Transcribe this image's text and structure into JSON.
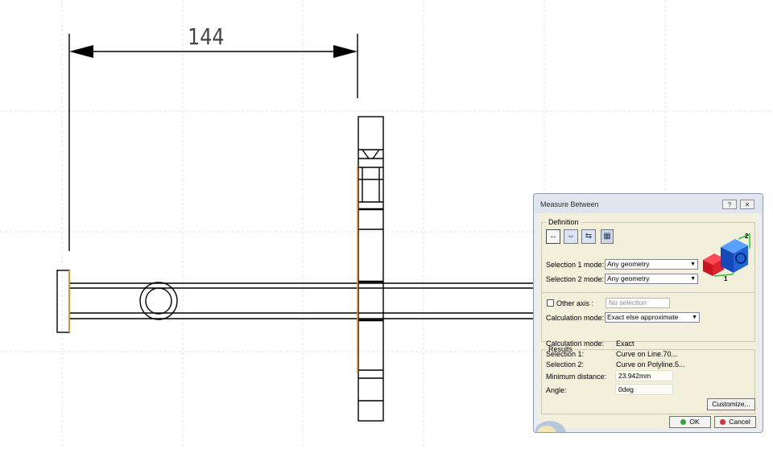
{
  "drawing": {
    "dimension_value": "144"
  },
  "dialog": {
    "title": "Measure Between",
    "help_label": "?",
    "close_label": "✕",
    "definition": {
      "legend": "Definition",
      "selection1_label": "Selection 1 mode:",
      "selection1_value": "Any geometry",
      "selection2_label": "Selection 2 mode:",
      "selection2_value": "Any geometry",
      "other_axis_label": "Other axis :",
      "other_axis_placeholder": "No selection",
      "other_axis_checked": false,
      "calc_mode_label": "Calculation mode:",
      "calc_mode_value": "Exact else approximate"
    },
    "results": {
      "legend": "Results",
      "calc_mode_label": "Calculation mode:",
      "calc_mode_value": "Exact",
      "sel1_label": "Selection 1:",
      "sel1_value": "Curve on Line.70...",
      "sel2_label": "Selection 2:",
      "sel2_value": "Curve on Polyline.5...",
      "min_dist_label": "Minimum distance:",
      "min_dist_value": "23.942mm",
      "angle_label": "Angle:",
      "angle_value": "0deg"
    },
    "buttons": {
      "customize": "Customize...",
      "ok": "OK",
      "cancel": "Cancel"
    },
    "preview_axis_labels": {
      "a": "1",
      "b": "2"
    }
  },
  "colors": {
    "highlight": "#e8952a",
    "ok_green": "#2fa335",
    "cancel_red": "#d23232",
    "cube_blue": "#1f63d8",
    "cube_red": "#d8232e"
  },
  "icons": [
    "measure-between-icon",
    "measure-in-chain-icon",
    "measure-fan-icon",
    "keep-measure-icon"
  ]
}
